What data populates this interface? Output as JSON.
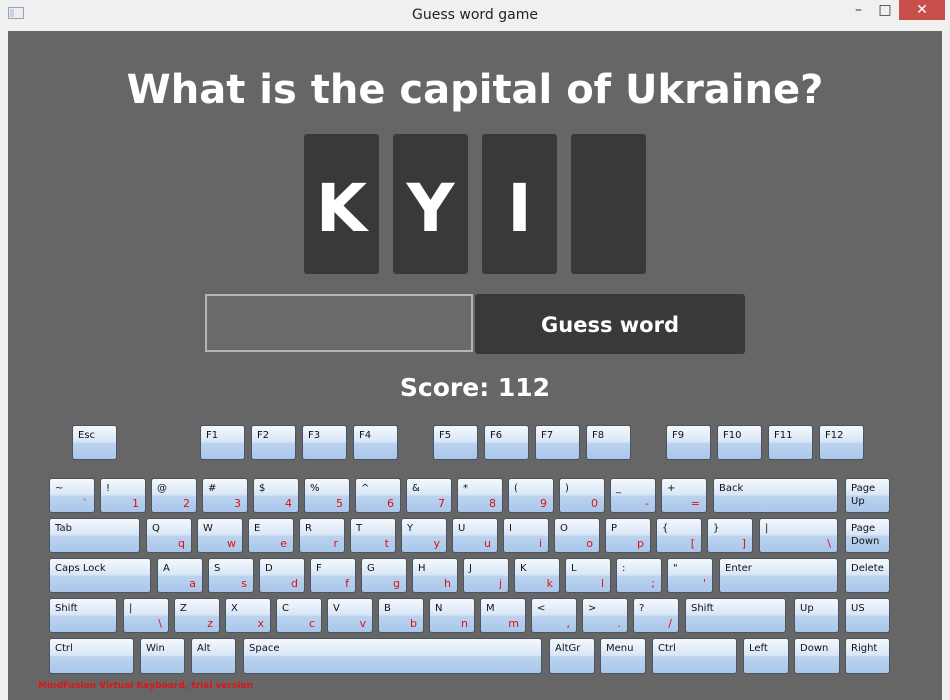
{
  "window": {
    "title": "Guess word game",
    "min_glyph": "–",
    "max_glyph": "□",
    "close_glyph": "✕"
  },
  "game": {
    "question": "What is the capital of Ukraine?",
    "tiles": [
      "K",
      "Y",
      "I",
      ""
    ],
    "input_value": "",
    "guess_label": "Guess word",
    "score": "Score: 112"
  },
  "keyboard": {
    "fn_row": [
      "Esc",
      "F1",
      "F2",
      "F3",
      "F4",
      "F5",
      "F6",
      "F7",
      "F8",
      "F9",
      "F10",
      "F11",
      "F12"
    ],
    "row1": [
      {
        "main": "~",
        "sub": "`"
      },
      {
        "main": "!",
        "sub": "1"
      },
      {
        "main": "@",
        "sub": "2"
      },
      {
        "main": "#",
        "sub": "3"
      },
      {
        "main": "$",
        "sub": "4"
      },
      {
        "main": "%",
        "sub": "5"
      },
      {
        "main": "^",
        "sub": "6"
      },
      {
        "main": "&",
        "sub": "7"
      },
      {
        "main": "*",
        "sub": "8"
      },
      {
        "main": "(",
        "sub": "9"
      },
      {
        "main": ")",
        "sub": "0"
      },
      {
        "main": "_",
        "sub": "-"
      },
      {
        "main": "+",
        "sub": "="
      },
      {
        "main": "Back",
        "sub": ""
      },
      {
        "main": "Page\nUp",
        "sub": ""
      }
    ],
    "row2": [
      {
        "main": "Tab",
        "sub": ""
      },
      {
        "main": "Q",
        "sub": "q"
      },
      {
        "main": "W",
        "sub": "w"
      },
      {
        "main": "E",
        "sub": "e"
      },
      {
        "main": "R",
        "sub": "r"
      },
      {
        "main": "T",
        "sub": "t"
      },
      {
        "main": "Y",
        "sub": "y"
      },
      {
        "main": "U",
        "sub": "u"
      },
      {
        "main": "I",
        "sub": "i"
      },
      {
        "main": "O",
        "sub": "o"
      },
      {
        "main": "P",
        "sub": "p"
      },
      {
        "main": "{",
        "sub": "["
      },
      {
        "main": "}",
        "sub": "]"
      },
      {
        "main": "|",
        "sub": "\\"
      },
      {
        "main": "Page\nDown",
        "sub": ""
      }
    ],
    "row3": [
      {
        "main": "Caps Lock",
        "sub": ""
      },
      {
        "main": "A",
        "sub": "a"
      },
      {
        "main": "S",
        "sub": "s"
      },
      {
        "main": "D",
        "sub": "d"
      },
      {
        "main": "F",
        "sub": "f"
      },
      {
        "main": "G",
        "sub": "g"
      },
      {
        "main": "H",
        "sub": "h"
      },
      {
        "main": "J",
        "sub": "j"
      },
      {
        "main": "K",
        "sub": "k"
      },
      {
        "main": "L",
        "sub": "l"
      },
      {
        "main": ":",
        "sub": ";"
      },
      {
        "main": "\"",
        "sub": "'"
      },
      {
        "main": "Enter",
        "sub": ""
      },
      {
        "main": "Delete",
        "sub": ""
      }
    ],
    "row4": [
      {
        "main": "Shift",
        "sub": ""
      },
      {
        "main": "|",
        "sub": "\\"
      },
      {
        "main": "Z",
        "sub": "z"
      },
      {
        "main": "X",
        "sub": "x"
      },
      {
        "main": "C",
        "sub": "c"
      },
      {
        "main": "V",
        "sub": "v"
      },
      {
        "main": "B",
        "sub": "b"
      },
      {
        "main": "N",
        "sub": "n"
      },
      {
        "main": "M",
        "sub": "m"
      },
      {
        "main": "<",
        "sub": ","
      },
      {
        "main": ">",
        "sub": "."
      },
      {
        "main": "?",
        "sub": "/"
      },
      {
        "main": "Shift",
        "sub": ""
      },
      {
        "main": "Up",
        "sub": ""
      },
      {
        "main": "US",
        "sub": ""
      }
    ],
    "row5": [
      {
        "main": "Ctrl",
        "sub": ""
      },
      {
        "main": "Win",
        "sub": ""
      },
      {
        "main": "Alt",
        "sub": ""
      },
      {
        "main": "Space",
        "sub": ""
      },
      {
        "main": "AltGr",
        "sub": ""
      },
      {
        "main": "Menu",
        "sub": ""
      },
      {
        "main": "Ctrl",
        "sub": ""
      },
      {
        "main": "Left",
        "sub": ""
      },
      {
        "main": "Down",
        "sub": ""
      },
      {
        "main": "Right",
        "sub": ""
      }
    ],
    "watermark": "MindFusion Virtual Keyboard, trial version"
  }
}
